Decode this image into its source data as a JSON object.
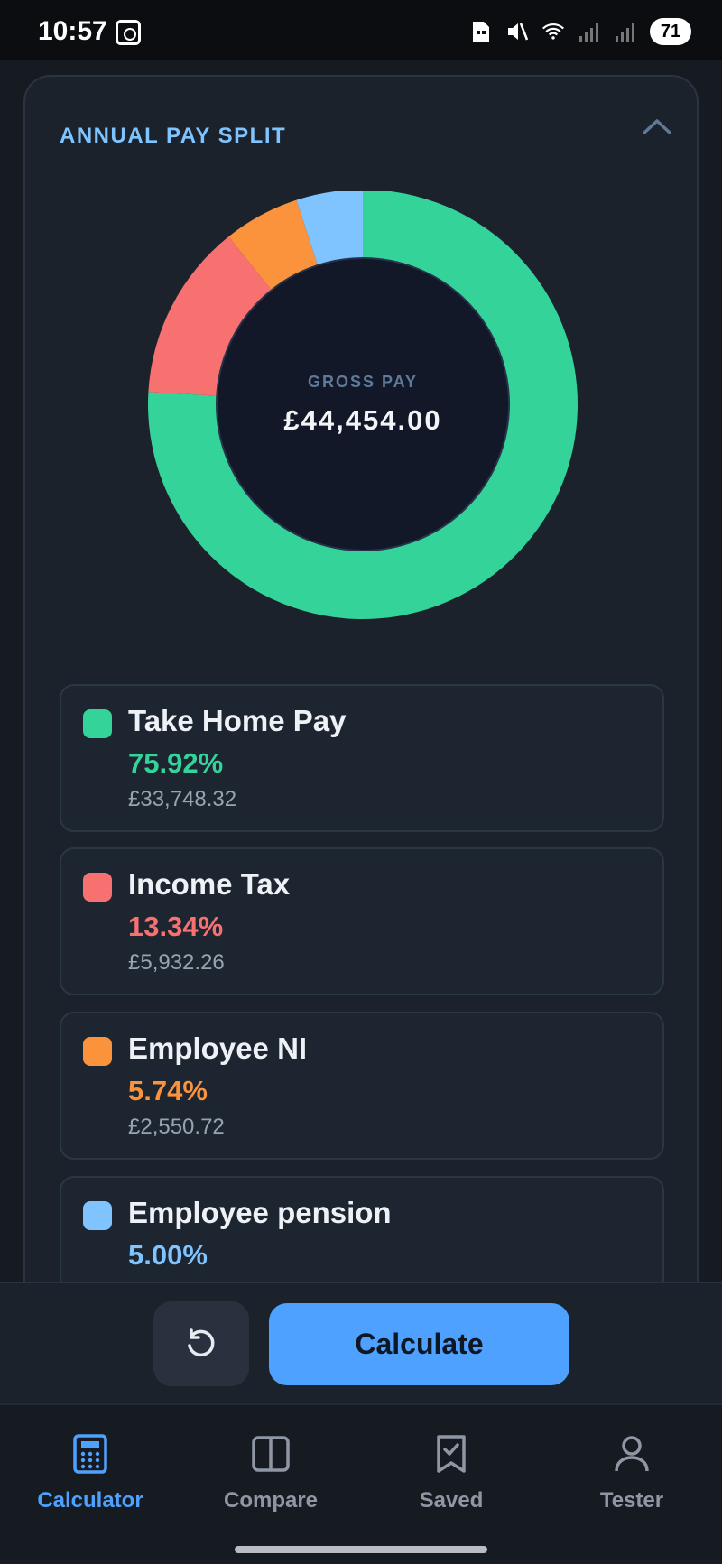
{
  "status_bar": {
    "time": "10:57",
    "battery": "71"
  },
  "card": {
    "title": "ANNUAL PAY SPLIT",
    "center_label": "GROSS PAY",
    "center_value": "£44,454.00"
  },
  "chart_data": {
    "type": "pie",
    "categories": [
      "Take Home Pay",
      "Income Tax",
      "Employee NI",
      "Employee pension"
    ],
    "values": [
      75.92,
      13.34,
      5.74,
      5.0
    ],
    "colors": [
      "#34d399",
      "#f87171",
      "#fb923c",
      "#7fc4ff"
    ]
  },
  "legend": [
    {
      "name": "Take Home Pay",
      "percent": "75.92%",
      "amount": "£33,748.32",
      "color": "#34d399"
    },
    {
      "name": "Income Tax",
      "percent": "13.34%",
      "amount": "£5,932.26",
      "color": "#f87171"
    },
    {
      "name": "Employee NI",
      "percent": "5.74%",
      "amount": "£2,550.72",
      "color": "#fb923c"
    },
    {
      "name": "Employee pension",
      "percent": "5.00%",
      "amount": "",
      "color": "#7fc4ff"
    }
  ],
  "actions": {
    "reset_icon": "reset-icon",
    "calculate_label": "Calculate"
  },
  "nav": [
    {
      "label": "Calculator",
      "icon": "calculator-icon",
      "active": true
    },
    {
      "label": "Compare",
      "icon": "compare-icon",
      "active": false
    },
    {
      "label": "Saved",
      "icon": "bookmark-check-icon",
      "active": false
    },
    {
      "label": "Tester",
      "icon": "user-icon",
      "active": false
    }
  ],
  "theme": {
    "accent": "#4ea1ff",
    "background": "#111419"
  }
}
